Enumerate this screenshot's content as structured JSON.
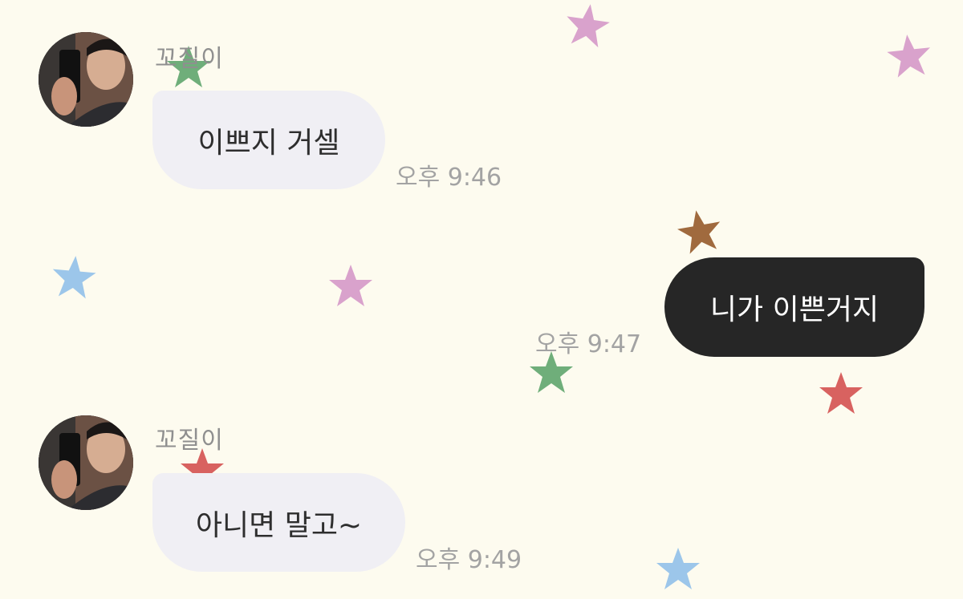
{
  "theme": {
    "background": "#fdfbef",
    "incoming_bubble": "#f0eff4",
    "outgoing_bubble": "#262626",
    "star_colors": [
      "#d9a2cc",
      "#6fae7a",
      "#9cc6ea",
      "#a06a3e",
      "#d86260"
    ]
  },
  "messages": [
    {
      "direction": "incoming",
      "sender": "꼬질이",
      "avatar": "profile-photo",
      "text": "이쁘지 거셀",
      "time": "오후 9:46"
    },
    {
      "direction": "outgoing",
      "text": "니가 이쁜거지",
      "time": "오후 9:47"
    },
    {
      "direction": "incoming",
      "sender": "꼬질이",
      "avatar": "profile-photo",
      "text": "아니면 말고~",
      "time": "오후 9:49"
    }
  ],
  "decorations": {
    "icon": "star-icon"
  }
}
